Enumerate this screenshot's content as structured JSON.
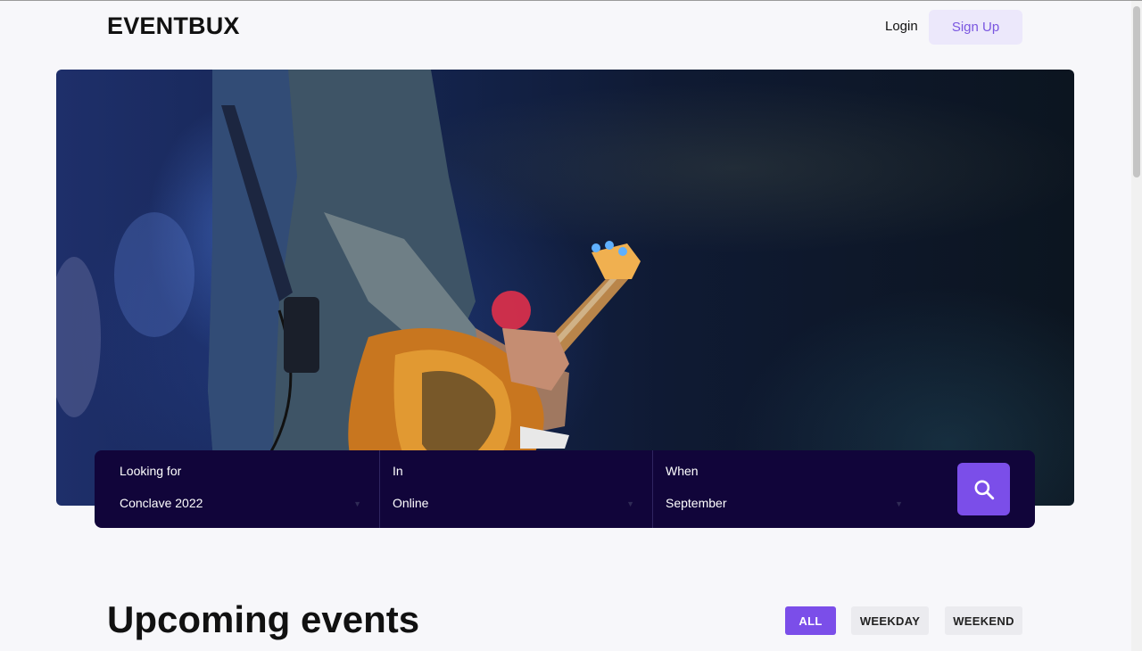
{
  "header": {
    "logo": "EVENTBUX",
    "login_label": "Login",
    "signup_label": "Sign Up"
  },
  "hero": {
    "image_icon": "concert-guitarist-image"
  },
  "search": {
    "looking_for_label": "Looking for",
    "looking_for_value": "Conclave 2022",
    "in_label": "In",
    "in_value": "Online",
    "when_label": "When",
    "when_value": "September",
    "search_icon": "search-icon"
  },
  "upcoming": {
    "title": "Upcoming events",
    "filters": [
      "ALL",
      "WEEKDAY",
      "WEEKEND"
    ],
    "active_filter": "ALL"
  },
  "colors": {
    "accent": "#7b4ee9",
    "search_bar_bg": "#11053a",
    "signup_bg": "#ece8fb",
    "page_bg": "#f7f7fa"
  }
}
